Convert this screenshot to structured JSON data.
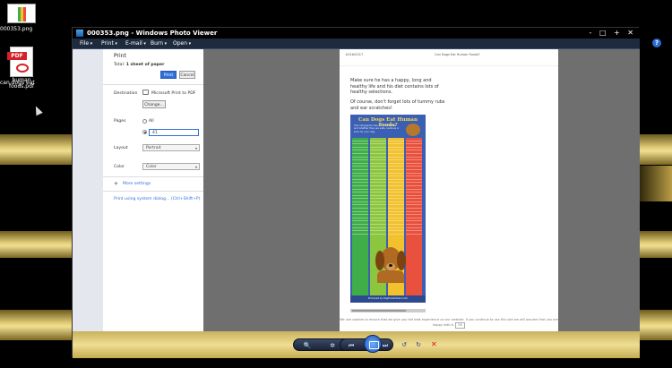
{
  "desktop": {
    "icons": [
      {
        "label": "000353.png"
      },
      {
        "label_line1": "can dogs eat",
        "label_line2": "human foods.pdf",
        "badge": "PDF"
      }
    ]
  },
  "window": {
    "title": "000353.png - Windows Photo Viewer",
    "controls": "- □ + ✕",
    "menu": [
      "File",
      "Print",
      "E-mail",
      "Burn",
      "Open"
    ]
  },
  "print": {
    "title": "Print",
    "total_prefix": "Total: ",
    "total_value": "1 sheet of paper",
    "print_button": "Print",
    "cancel_button": "Cancel",
    "destination_label": "Destination",
    "destination_value": "Microsoft Print to PDF",
    "change_button": "Change...",
    "pages_label": "Pages",
    "pages_all": "All",
    "pages_custom": "41",
    "layout_label": "Layout",
    "layout_value": "Portrait",
    "color_label": "Color",
    "color_value": "Color",
    "more_settings": "More settings",
    "system_dialog": "Print using system dialog... (Ctrl+Shift+P)"
  },
  "preview": {
    "header_left": "10/16/2017",
    "header_center": "Can Dogs Eat Human Foods?",
    "para1": "Make sure he has a happy, long and healthy life and his diet contains lots of healthy selections.",
    "para2": "Of course, don't forget lots of tummy rubs and ear scratches!",
    "infographic_title": "Can Dogs Eat Human Foods?",
    "infographic_sub": "This infographic lists common foods and whether they are safe, cautious or toxic for your dog.",
    "infographic_footer": "Produced by DogFoodAdvisor.com",
    "cookie_text": "We use cookies to ensure that we give you the best experience on our website. If you continue to use this site we will assume that you are happy with it.",
    "cookie_ok": "Ok",
    "columns": [
      {
        "color": "#3fae49"
      },
      {
        "color": "#8cc63f"
      },
      {
        "color": "#f2c12e"
      },
      {
        "color": "#e9503e"
      }
    ]
  },
  "toolbar": {
    "icons": [
      "zoom-icon",
      "fit-icon",
      "previous-icon",
      "slideshow-icon",
      "next-icon",
      "rotate-ccw-icon",
      "rotate-cw-icon",
      "delete-icon"
    ]
  }
}
